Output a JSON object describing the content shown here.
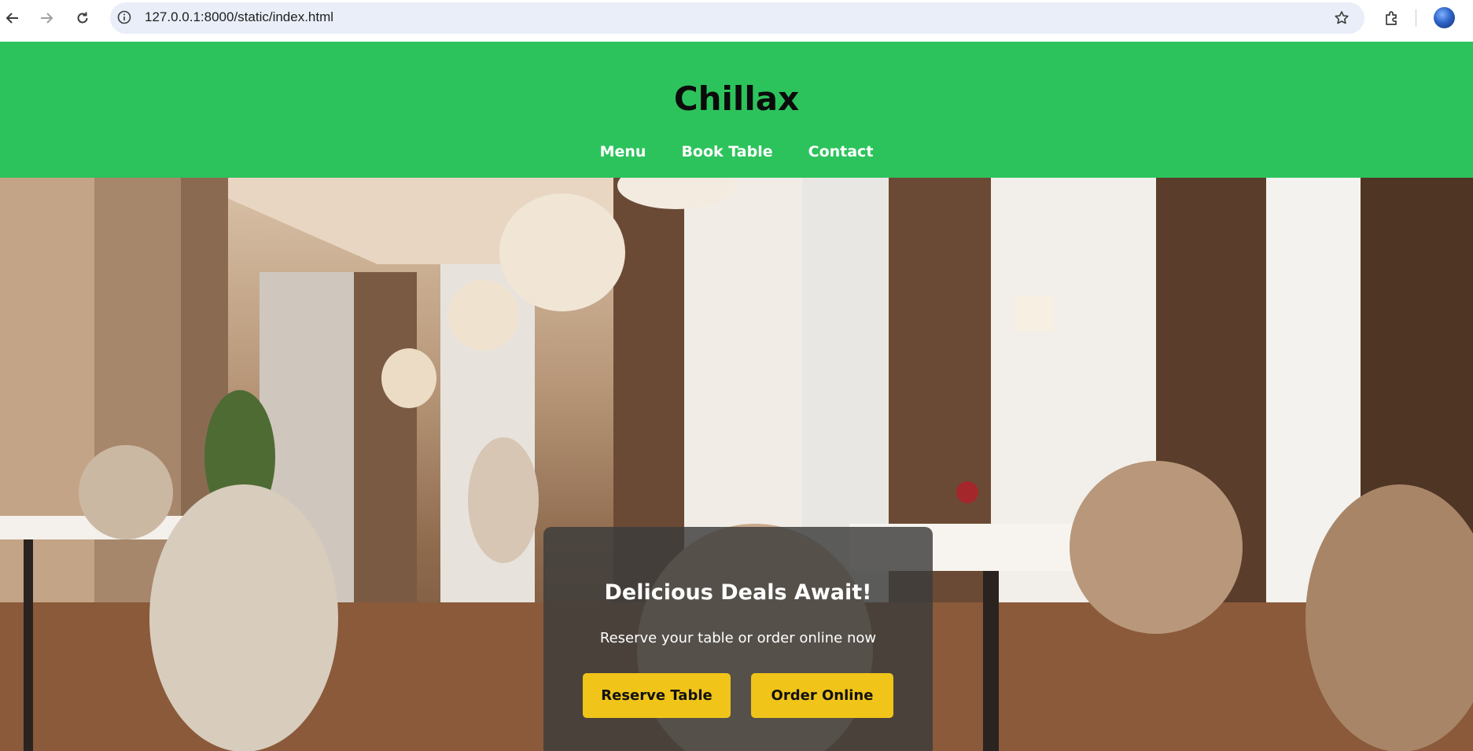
{
  "browser": {
    "url": "127.0.0.1:8000/static/index.html",
    "icons": [
      "back-arrow-icon",
      "forward-arrow-icon",
      "reload-icon",
      "site-info-icon",
      "bookmark-star-icon",
      "extensions-icon",
      "profile-avatar"
    ]
  },
  "site": {
    "title": "Chillax",
    "nav": [
      "Menu",
      "Book Table",
      "Contact"
    ],
    "colors": {
      "header_bg": "#2dc35c",
      "button_bg": "#f0c419",
      "card_bg": "#3c3c3c"
    }
  },
  "hero": {
    "title": "Delicious Deals Await!",
    "subtitle": "Reserve your table or order online now",
    "buttons": [
      "Reserve Table",
      "Order Online"
    ]
  }
}
